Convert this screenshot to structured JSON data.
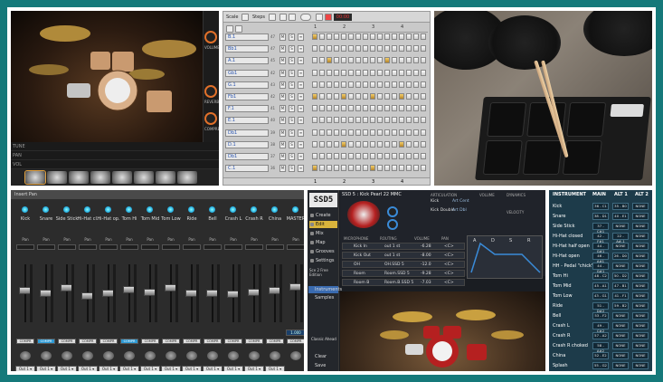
{
  "colors": {
    "frame": "#15797a",
    "accent_orange": "#e0702a",
    "ssd5_gold": "#d9b43c",
    "mixer_comp_on": "#2e9ad4",
    "table_bg": "#1d3b4a"
  },
  "kit": {
    "knob_labels": [
      "VOLUME",
      "REVERB",
      "COMPRESS"
    ],
    "knob_values": [
      "0%",
      "0%",
      "0%"
    ],
    "mix_rows": [
      "TUNE",
      "PAN",
      "VOL"
    ]
  },
  "sequencer": {
    "toolbar": {
      "scale_label": "Scale",
      "steps_label": "Steps",
      "lcd": "00:00"
    },
    "ruler": [
      "1",
      "2",
      "3",
      "4"
    ],
    "bottom_labels": [
      "1",
      "2",
      "3",
      "4"
    ],
    "tracks": [
      {
        "name": "B.1",
        "num": "47"
      },
      {
        "name": "Bb1",
        "num": "47"
      },
      {
        "name": "A.1",
        "num": "45"
      },
      {
        "name": "Gb1",
        "num": "42"
      },
      {
        "name": "G.1",
        "num": "43"
      },
      {
        "name": "Fb1",
        "num": "42"
      },
      {
        "name": "F.1",
        "num": "41"
      },
      {
        "name": "E.1",
        "num": "40"
      },
      {
        "name": "Db1",
        "num": "39"
      },
      {
        "name": "D.1",
        "num": "38"
      },
      {
        "name": "Db1",
        "num": "37"
      },
      {
        "name": "C.1",
        "num": "36"
      }
    ],
    "active_steps": [
      [
        0
      ],
      [],
      [
        2,
        10
      ],
      [],
      [],
      [
        0,
        4,
        8,
        12
      ],
      [],
      [],
      [],
      [
        4,
        12
      ],
      [],
      [
        0,
        8
      ]
    ]
  },
  "mixer": {
    "title": "Insert Pan",
    "channels": [
      "Kick",
      "Snare",
      "Side Stick",
      "Hi-Hat cl.",
      "Hi-Hat op.",
      "Tom Hi",
      "Tom Mid",
      "Tom Low",
      "Ride",
      "Bell",
      "Crash L",
      "Crash R",
      "China",
      "MASTER"
    ],
    "comp_on": [
      false,
      true,
      false,
      false,
      false,
      true,
      false,
      false,
      false,
      false,
      false,
      false,
      false,
      false
    ],
    "pan_label": "Pan",
    "comp_label": "COMPR",
    "out_labels": [
      "Out 1 ▾",
      "Out 1 ▾",
      "Out 1 ▾",
      "Out 1 ▾",
      "Out 1 ▾",
      "Out 1 ▾",
      "Out 1 ▾",
      "Out 1 ▾",
      "Out 1 ▾",
      "Out 1 ▾",
      "Out 1 ▾",
      "Out 1 ▾",
      "Out 1 ▾",
      ""
    ],
    "master_value": "1.000",
    "fader_levels": [
      0.55,
      0.5,
      0.6,
      0.45,
      0.5,
      0.58,
      0.52,
      0.6,
      0.5,
      0.5,
      0.48,
      0.52,
      0.55,
      0.62
    ]
  },
  "ssd5": {
    "logo": "SSD5",
    "title": "SSD 5 : Kick Pearl 22 MMC",
    "nav": [
      "Create",
      "Edit",
      "Mix",
      "Map",
      "Grooves",
      "Settings"
    ],
    "nav_selected": 1,
    "edition": "Sce 2 Free Edition",
    "tabs2": [
      "Instruments",
      "Samples"
    ],
    "bottom_nav": [
      "Clear",
      "Save"
    ],
    "headers": [
      "MICROPHONE",
      "ROUTING",
      "VOLUME",
      "PAN"
    ],
    "top_headers": [
      "ARTICULATION",
      "VOLUME",
      "DYNAMICS",
      "VELOCITY"
    ],
    "articulations": [
      {
        "name": "Kick",
        "value": "Art Cent"
      },
      {
        "name": "Kick Double",
        "value": "Art Dbl"
      }
    ],
    "mic_rows": [
      {
        "mic": "Kick In",
        "route": "out 1 st",
        "vol": "-6.28",
        "pan": "<C>"
      },
      {
        "mic": "Kick Out",
        "route": "out 1 st",
        "vol": "-8.00",
        "pan": "<C>"
      },
      {
        "mic": "OH",
        "route": "OH.SSD 5",
        "vol": "-12.0",
        "pan": "<C>"
      },
      {
        "mic": "Room",
        "route": "Room.SSD 5",
        "vol": "-9.28",
        "pan": "<C>"
      },
      {
        "mic": "Room B",
        "route": "Room.B.SSD 5",
        "vol": "-7.03",
        "pan": "<C>"
      }
    ],
    "env_labels": [
      "A",
      "D",
      "S",
      "R"
    ],
    "status": "Classic Ahead"
  },
  "mapping": {
    "headers": [
      "INSTRUMENT",
      "MAIN",
      "ALT 1",
      "ALT 2"
    ],
    "rows": [
      {
        "name": "Kick",
        "main": "36 - C1",
        "alt1": "35 - B0",
        "alt2": "NONE"
      },
      {
        "name": "Snare",
        "main": "38 - D1",
        "alt1": "40 - E1",
        "alt2": "NONE"
      },
      {
        "name": "Side Stick",
        "main": "37 - C#1",
        "alt1": "NONE",
        "alt2": "NONE"
      },
      {
        "name": "Hi-Hat closed",
        "main": "42 - F#1",
        "alt1": "22 - A#-1",
        "alt2": "NONE"
      },
      {
        "name": "Hi-Hat half open",
        "main": "44 - G#1",
        "alt1": "NONE",
        "alt2": "NONE"
      },
      {
        "name": "Hi-Hat open",
        "main": "46 - A#1",
        "alt1": "26 - D0",
        "alt2": "NONE"
      },
      {
        "name": "HH - Pedal \"chick\"",
        "main": "44 - G#1",
        "alt1": "NONE",
        "alt2": "NONE"
      },
      {
        "name": "Tom Hi",
        "main": "48 - C2",
        "alt1": "50 - D2",
        "alt2": "NONE"
      },
      {
        "name": "Tom Mid",
        "main": "45 - A1",
        "alt1": "47 - B1",
        "alt2": "NONE"
      },
      {
        "name": "Tom Low",
        "main": "43 - G1",
        "alt1": "41 - F1",
        "alt2": "NONE"
      },
      {
        "name": "Ride",
        "main": "51 - D#2",
        "alt1": "59 - B2",
        "alt2": "NONE"
      },
      {
        "name": "Bell",
        "main": "53 - F2",
        "alt1": "NONE",
        "alt2": "NONE"
      },
      {
        "name": "Crash L",
        "main": "49 - C#2",
        "alt1": "NONE",
        "alt2": "NONE"
      },
      {
        "name": "Crash R",
        "main": "57 - A2",
        "alt1": "NONE",
        "alt2": "NONE"
      },
      {
        "name": "Crash R choked",
        "main": "58 - A#2",
        "alt1": "NONE",
        "alt2": "NONE"
      },
      {
        "name": "China",
        "main": "52 - E2",
        "alt1": "NONE",
        "alt2": "NONE"
      },
      {
        "name": "Splash",
        "main": "55 - G2",
        "alt1": "NONE",
        "alt2": "NONE"
      }
    ]
  }
}
